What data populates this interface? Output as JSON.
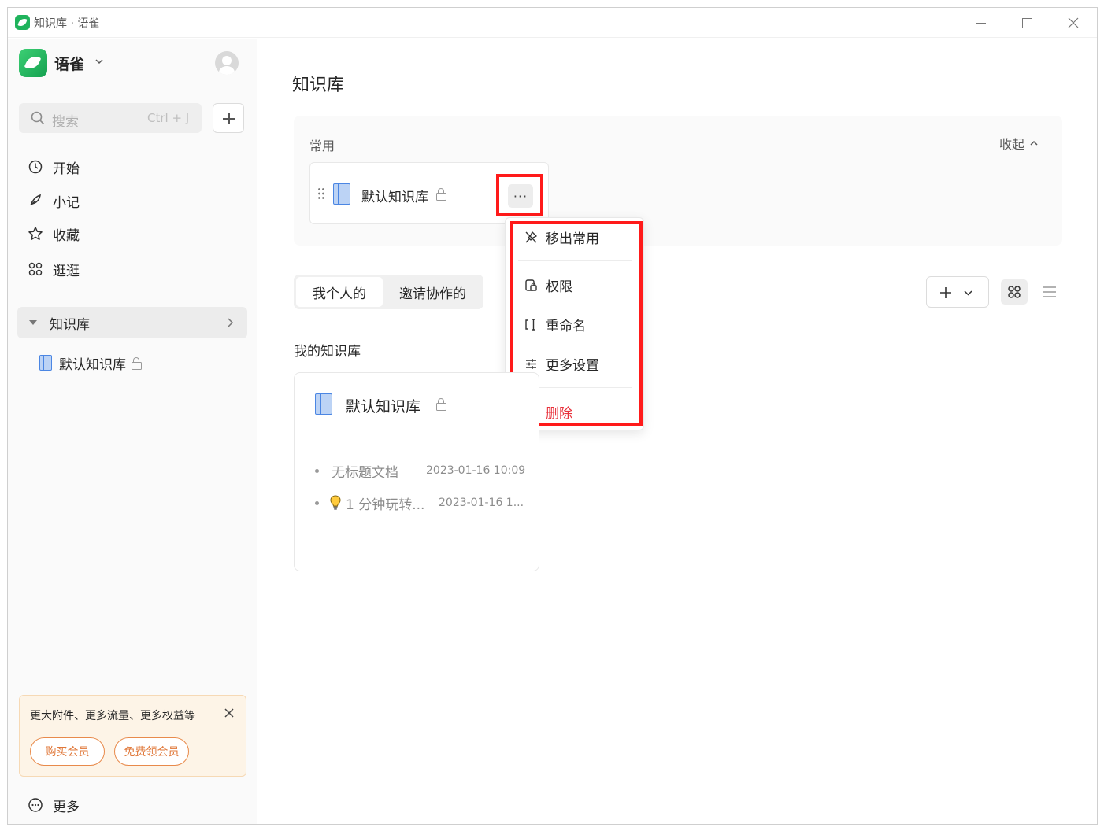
{
  "window": {
    "title": "知识库 · 语雀"
  },
  "sidebar": {
    "brand": "语雀",
    "search": {
      "placeholder": "搜索",
      "shortcut": "Ctrl + J"
    },
    "nav": [
      {
        "label": "开始",
        "icon": "clock-icon"
      },
      {
        "label": "小记",
        "icon": "feather-icon"
      },
      {
        "label": "收藏",
        "icon": "star-icon"
      },
      {
        "label": "逛逛",
        "icon": "grid-icon"
      }
    ],
    "knowledge_section": {
      "label": "知识库"
    },
    "knowledge_items": [
      {
        "label": "默认知识库"
      }
    ],
    "promo": {
      "text": "更大附件、更多流量、更多权益等",
      "buy_label": "购买会员",
      "free_label": "免费领会员"
    },
    "more_label": "更多"
  },
  "main": {
    "title": "知识库",
    "common": {
      "label": "常用",
      "collapse_label": "收起",
      "card_name": "默认知识库",
      "more_label": "···"
    },
    "context_menu": {
      "items": [
        {
          "label": "移出常用",
          "icon": "unpin-icon"
        },
        {
          "label": "权限",
          "icon": "permission-icon"
        },
        {
          "label": "重命名",
          "icon": "rename-icon"
        },
        {
          "label": "更多设置",
          "icon": "settings-sliders-icon"
        },
        {
          "label": "删除",
          "icon": "trash-icon",
          "color": "#e8323c"
        }
      ]
    },
    "tabs": [
      {
        "label": "我个人的",
        "active": true
      },
      {
        "label": "邀请协作的",
        "active": false
      }
    ],
    "section_title": "我的知识库",
    "kb_card": {
      "name": "默认知识库",
      "docs": [
        {
          "title": "无标题文档",
          "time": "2023-01-16 10:09"
        },
        {
          "title": "1 分钟玩转...",
          "time": "2023-01-16 1...",
          "icon": "lightbulb-icon"
        }
      ]
    }
  },
  "colors": {
    "brand": "#1fb35c",
    "highlight": "#ff1a1a",
    "danger": "#e8323c",
    "book": "#4b86e3"
  }
}
